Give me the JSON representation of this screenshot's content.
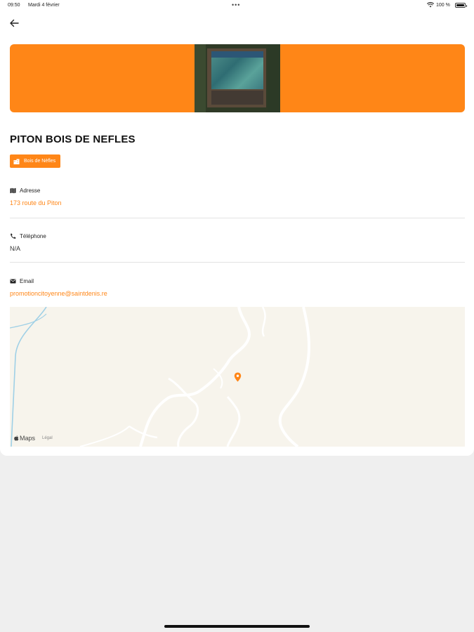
{
  "status_bar": {
    "time": "09:50",
    "date": "Mardi 4 février",
    "dots": "•••",
    "battery_pct": "100 %"
  },
  "nav": {
    "back_icon": "arrow-left-icon"
  },
  "place": {
    "title": "PITON BOIS DE NEFLES",
    "category": "Bois de Nèfles",
    "category_icon": "building-icon"
  },
  "info": {
    "address": {
      "label": "Adresse",
      "value": "173 route du Piton",
      "icon": "map-icon"
    },
    "phone": {
      "label": "Téléphone",
      "value": "N/A",
      "icon": "phone-icon"
    },
    "email": {
      "label": "Email",
      "value": "promotioncitoyenne@saintdenis.re",
      "icon": "envelope-icon"
    }
  },
  "map": {
    "brand": "Maps",
    "legal": "Légal",
    "pin_icon": "map-pin-icon"
  },
  "colors": {
    "accent": "#ff8617",
    "map_background": "#f7f4ec"
  }
}
